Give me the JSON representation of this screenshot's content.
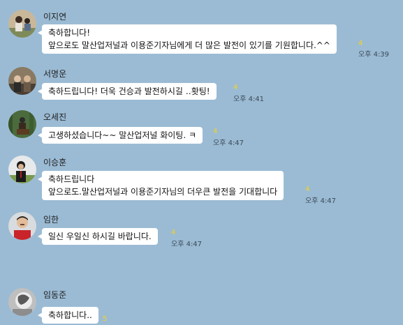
{
  "colors": {
    "chat_background": "#9bbbd4",
    "bubble": "#ffffff",
    "unread_count": "#f3d41c"
  },
  "messages": [
    {
      "sender": "이지연",
      "lines": [
        "축하합니다!",
        "앞으로도 말산업저널과 이용준기자님에게 더 많은 발전이 있기를 기원합니다.^^"
      ],
      "unread": "4",
      "time": "오후 4:39"
    },
    {
      "sender": "서명운",
      "lines": [
        "축하드립니다!  더욱 건승과 발전하시길 ‥홧팅!"
      ],
      "unread": "4",
      "time": "오후 4:41"
    },
    {
      "sender": "오세진",
      "lines": [
        "고생하셨습니다~~ 말산업저널 화이팅. ㅋ"
      ],
      "unread": "4",
      "time": "오후 4:47"
    },
    {
      "sender": "이승훈",
      "lines": [
        "축하드립니다",
        "앞으로도.말산업저널과 이용준기자님의 더우큰 발전을 기대합니다"
      ],
      "unread": "4",
      "time": "오후 4:47"
    },
    {
      "sender": "임한",
      "lines": [
        "일신 우일신 하시길  바랍니다."
      ],
      "unread": "4",
      "time": "오후 4:47"
    },
    {
      "sender": "임동준",
      "lines": [
        "축하합니다.."
      ],
      "unread": "5",
      "time": ""
    }
  ]
}
